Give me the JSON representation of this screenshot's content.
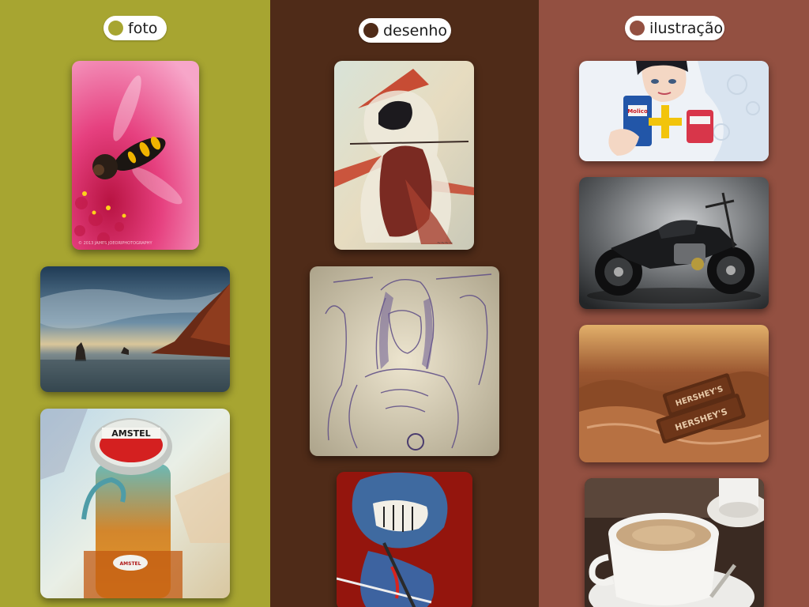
{
  "columns": [
    {
      "id": "foto",
      "label": "foto",
      "bg": "#a7a531",
      "dot": "#a7a531",
      "items": [
        {
          "name": "photo-bee-flower",
          "caption": "© 2013 JAMES JOEORIPHOTOGRAPHY"
        },
        {
          "name": "photo-coast-sea"
        },
        {
          "name": "photo-amstel-bottle",
          "cap_text": "AMSTEL",
          "label_text": "AMSTEL"
        }
      ]
    },
    {
      "id": "desenho",
      "label": "desenho",
      "bg": "#4f2b18",
      "dot": "#4f2b18",
      "items": [
        {
          "name": "drawing-samurai"
        },
        {
          "name": "drawing-barbarian-sketch"
        },
        {
          "name": "drawing-blue-monster"
        }
      ]
    },
    {
      "id": "ilustracao",
      "label": "ilustração",
      "bg": "#935041",
      "dot": "#935041",
      "items": [
        {
          "name": "illustration-yogurt-ad",
          "brand_text": "Molico"
        },
        {
          "name": "illustration-motorcycle"
        },
        {
          "name": "illustration-chocolate",
          "brand_text": "HERSHEY'S"
        },
        {
          "name": "illustration-coffee-cup"
        }
      ]
    }
  ]
}
